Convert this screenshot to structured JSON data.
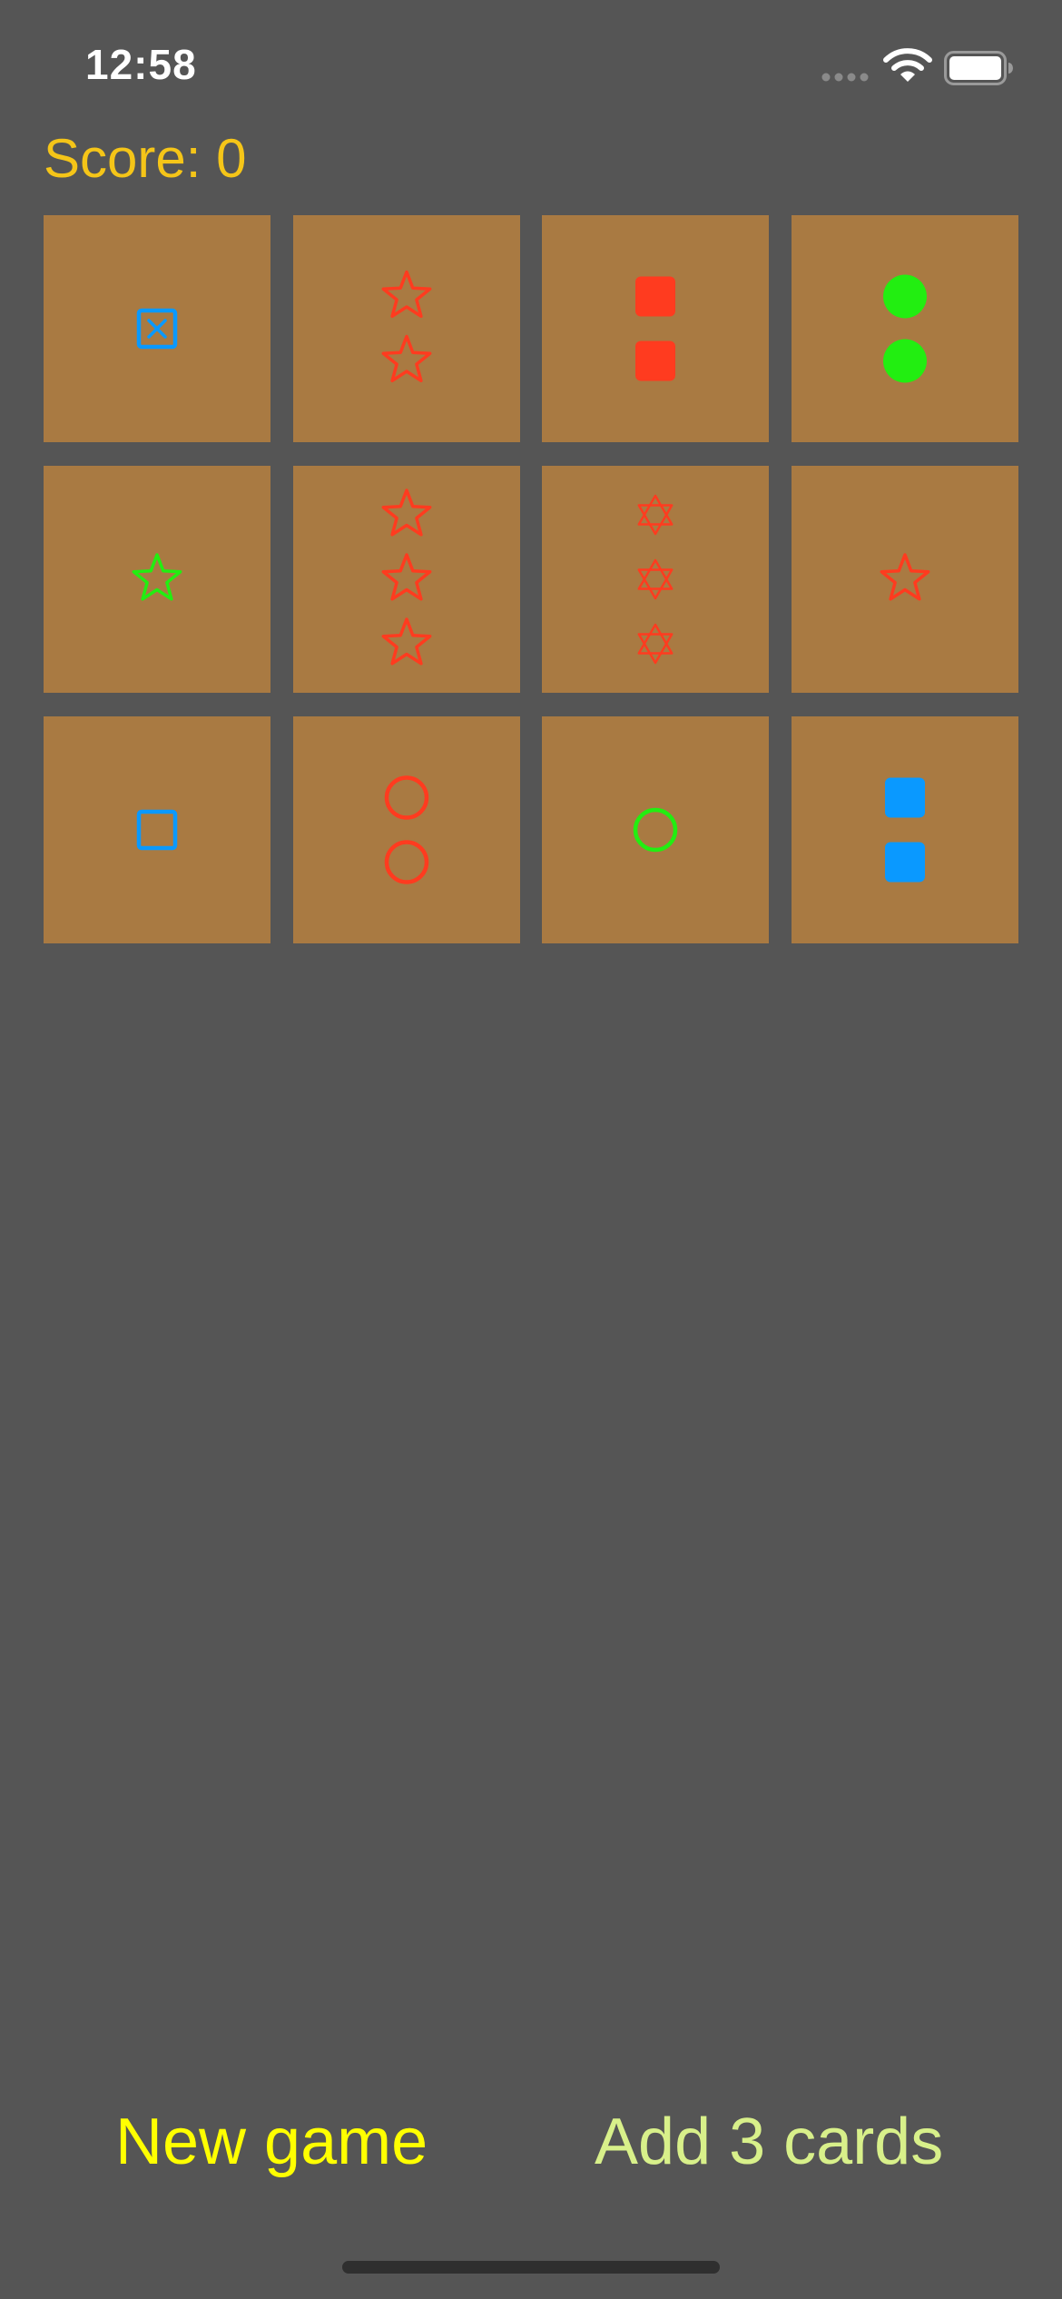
{
  "status_bar": {
    "time": "12:58",
    "signal_icon": "cellular-signal-dots",
    "wifi_icon": "wifi-icon",
    "battery_icon": "battery-icon"
  },
  "score_label": "Score: 0",
  "colors": {
    "background": "#555555",
    "card": "#a97a42",
    "score": "#f5c518",
    "new_game": "#ffff00",
    "add_cards": "#d8f08a",
    "red": "#ff3b1f",
    "green": "#22ee11",
    "blue": "#0a99ff"
  },
  "cards": [
    {
      "shape": "square-x",
      "count": 1,
      "color": "blue",
      "fill": "outline"
    },
    {
      "shape": "star",
      "count": 2,
      "color": "red",
      "fill": "outline"
    },
    {
      "shape": "rounded-square",
      "count": 2,
      "color": "red",
      "fill": "solid"
    },
    {
      "shape": "circle",
      "count": 2,
      "color": "green",
      "fill": "solid"
    },
    {
      "shape": "star",
      "count": 1,
      "color": "green",
      "fill": "outline"
    },
    {
      "shape": "star",
      "count": 3,
      "color": "red",
      "fill": "outline"
    },
    {
      "shape": "hexagram",
      "count": 3,
      "color": "red",
      "fill": "outline"
    },
    {
      "shape": "star",
      "count": 1,
      "color": "red",
      "fill": "outline"
    },
    {
      "shape": "square",
      "count": 1,
      "color": "blue",
      "fill": "outline"
    },
    {
      "shape": "circle",
      "count": 2,
      "color": "red",
      "fill": "outline"
    },
    {
      "shape": "circle",
      "count": 1,
      "color": "green",
      "fill": "outline"
    },
    {
      "shape": "rounded-square",
      "count": 2,
      "color": "blue",
      "fill": "solid"
    }
  ],
  "buttons": {
    "new_game": "New game",
    "add_cards": "Add 3 cards"
  }
}
